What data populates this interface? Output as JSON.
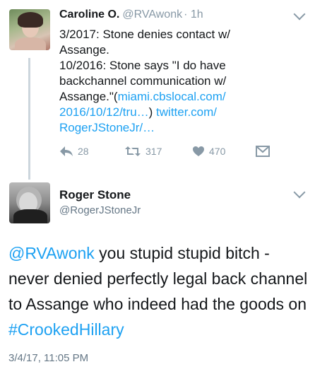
{
  "tweet1": {
    "name": "Caroline O.",
    "handle": "@RVAwonk",
    "time": "· 1h",
    "text_plain": "3/2017: Stone denies contact w/\nAssange.\n10/2016: Stone says \"I do have\nbackchannel communication w/\nAssange.\"(",
    "link1": "miami.cbslocal.com/\n2016/10/12/tru…",
    "text_mid": ") ",
    "link2": "twitter.com/\nRogerJStoneJr/…",
    "reply_count": "28",
    "retweet_count": "317",
    "like_count": "470",
    "icons": [
      "reply-icon",
      "retweet-icon",
      "heart-icon",
      "dm-icon",
      "chevron-down-icon"
    ]
  },
  "tweet2": {
    "name": "Roger Stone",
    "handle": "@RogerJStoneJr",
    "mention": "@RVAwonk",
    "text_a": " you stupid stupid bitch - never denied perfectly legal back channel to Assange who indeed had the goods on ",
    "hashtag": "#CrookedHillary",
    "timestamp": "3/4/17, 11:05 PM"
  },
  "colors": {
    "link": "#1da1f2",
    "muted": "#8899a6",
    "text": "#14171a"
  }
}
